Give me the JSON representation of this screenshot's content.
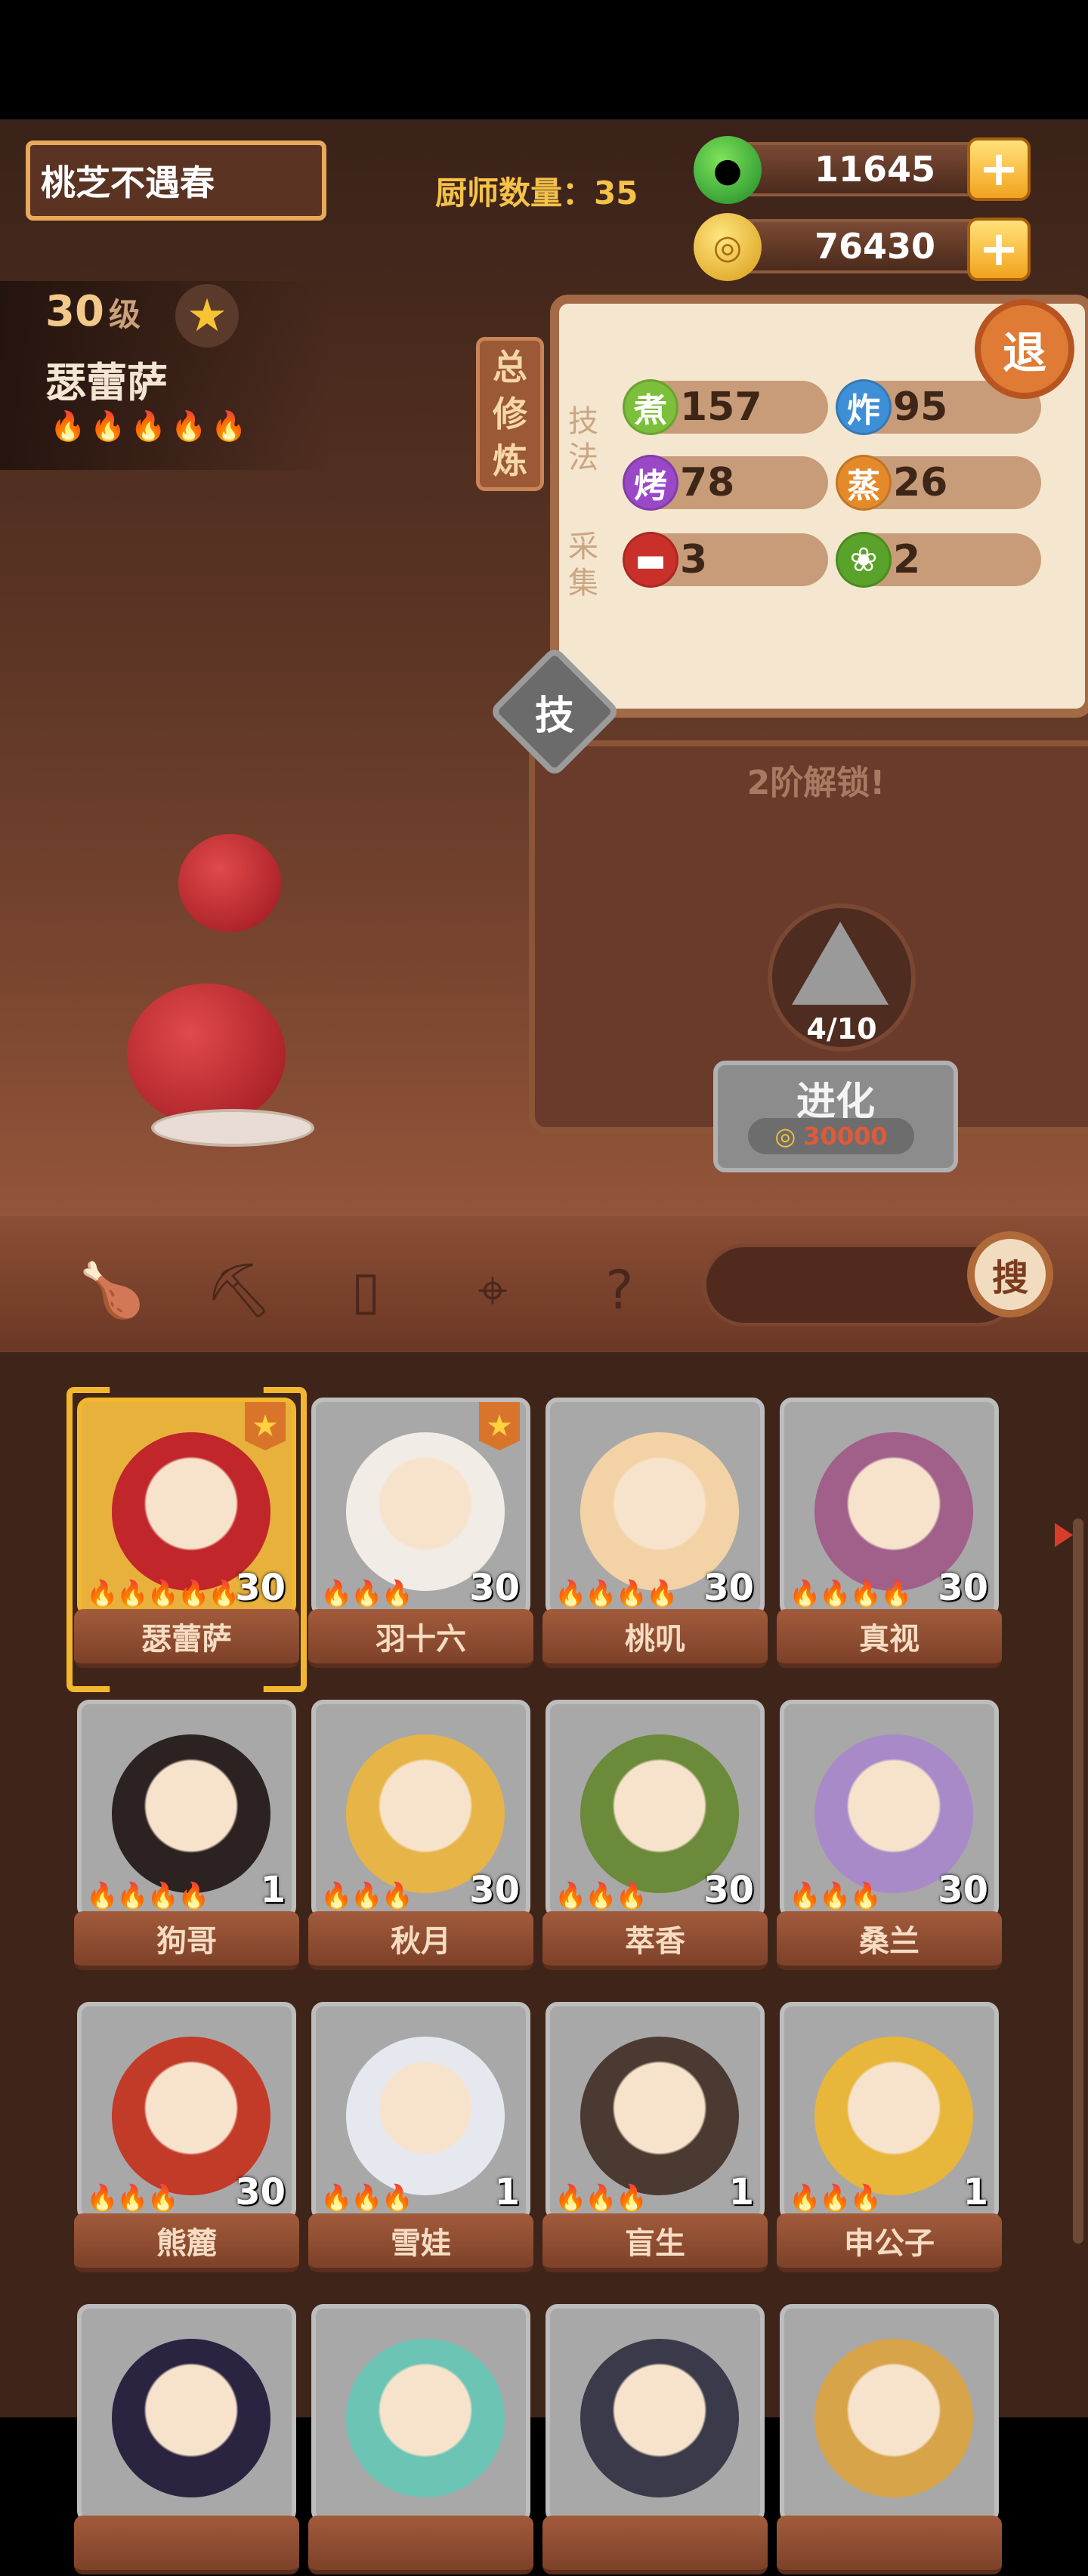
{
  "header": {
    "player_name": "桃芝不遇春",
    "chef_count_label": "厨师数量：35",
    "jade": "11645",
    "gold": "76430",
    "plus_symbol": "+",
    "exit_label": "退"
  },
  "character": {
    "level": "30",
    "level_unit": "级",
    "name": "瑟蕾萨",
    "flames": "🔥🔥🔥🔥🔥"
  },
  "training_tab": "总修炼",
  "skills": {
    "section_label": "技法",
    "boil": {
      "icon": "煮",
      "value": "157",
      "color": "#7cbf3a"
    },
    "fry": {
      "icon": "炸",
      "value": "95",
      "color": "#3f8fd6"
    },
    "roast": {
      "icon": "烤",
      "value": "78",
      "color": "#9a48c7"
    },
    "steam": {
      "icon": "蒸",
      "value": "26",
      "color": "#e58a2a"
    }
  },
  "gather": {
    "section_label": "采集",
    "meat": {
      "icon": "meat-icon",
      "value": "3"
    },
    "veg": {
      "icon": "cabbage-icon",
      "value": "2"
    }
  },
  "skill_button": "技",
  "unlock_text": "2阶解锁!",
  "evolve": {
    "progress": "4/10",
    "label": "进化",
    "cost": "30000"
  },
  "search_label": "搜",
  "chefs": [
    {
      "name": "瑟蕾萨",
      "level": "30",
      "flames": "🔥🔥🔥🔥🔥",
      "starred": true,
      "selected": true,
      "color": "#c0262a"
    },
    {
      "name": "羽十六",
      "level": "30",
      "flames": "🔥🔥🔥",
      "starred": true,
      "color": "#f1ece6"
    },
    {
      "name": "桃叽",
      "level": "30",
      "flames": "🔥🔥🔥🔥",
      "color": "#f3d2a6"
    },
    {
      "name": "真视",
      "level": "30",
      "flames": "🔥🔥🔥🔥",
      "color": "#a0608a"
    },
    {
      "name": "狗哥",
      "level": "1",
      "flames": "🔥🔥🔥🔥",
      "color": "#2c2222"
    },
    {
      "name": "秋月",
      "level": "30",
      "flames": "🔥🔥🔥",
      "color": "#e7b447"
    },
    {
      "name": "萃香",
      "level": "30",
      "flames": "🔥🔥🔥",
      "color": "#6b8a3a"
    },
    {
      "name": "桑兰",
      "level": "30",
      "flames": "🔥🔥🔥",
      "color": "#a98ac8"
    },
    {
      "name": "熊麓",
      "level": "30",
      "flames": "🔥🔥🔥",
      "color": "#c23a28"
    },
    {
      "name": "雪娃",
      "level": "1",
      "flames": "🔥🔥🔥",
      "color": "#e6e8f0"
    },
    {
      "name": "盲生",
      "level": "1",
      "flames": "🔥🔥🔥",
      "color": "#4a3a32"
    },
    {
      "name": "申公子",
      "level": "1",
      "flames": "🔥🔥🔥",
      "color": "#e8b63a"
    },
    {
      "name": "",
      "level": "",
      "flames": "",
      "color": "#2a2440"
    },
    {
      "name": "",
      "level": "",
      "flames": "",
      "color": "#6cc4b4"
    },
    {
      "name": "",
      "level": "",
      "flames": "",
      "color": "#3a3a4a"
    },
    {
      "name": "",
      "level": "",
      "flames": "",
      "color": "#d8a44a"
    }
  ]
}
